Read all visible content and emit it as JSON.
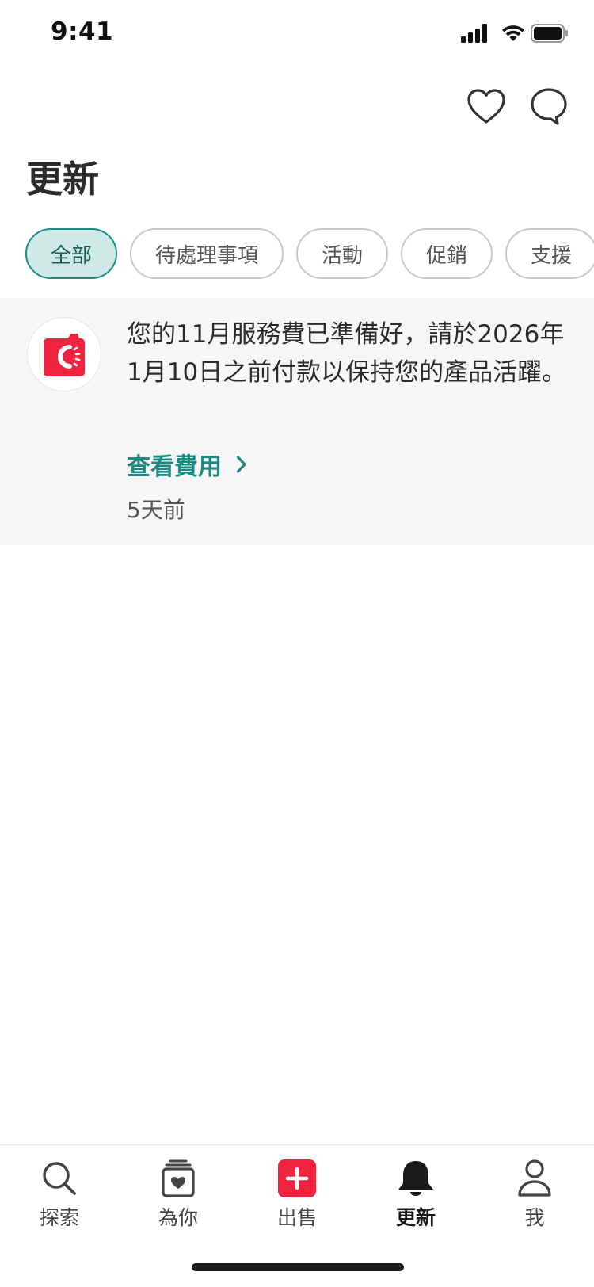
{
  "status_bar": {
    "time": "9:41"
  },
  "header": {
    "title": "更新",
    "actions": [
      {
        "icon": "heart-icon"
      },
      {
        "icon": "chat-bubble-icon"
      }
    ]
  },
  "filters": {
    "selected": "全部",
    "chips": [
      "全部",
      "待處理事項",
      "活動",
      "促銷",
      "支援"
    ]
  },
  "notifications": [
    {
      "app_icon": "carousell-logo-icon",
      "message": "您的11月服務費已準備好，請於2026年1月10日之前付款以保持您的產品活躍。",
      "link_label": "查看費用",
      "time": "5天前"
    }
  ],
  "tab_bar": {
    "active": "更新",
    "tabs": [
      {
        "label": "探索",
        "icon": "search-icon"
      },
      {
        "label": "為你",
        "icon": "for-you-icon"
      },
      {
        "label": "出售",
        "icon": "sell-plus-icon"
      },
      {
        "label": "更新",
        "icon": "bell-icon"
      },
      {
        "label": "我",
        "icon": "profile-icon"
      }
    ]
  },
  "colors": {
    "accent": "#1b8a82",
    "chip_active_bg": "#cfe9e6",
    "sell_button": "#f0233f",
    "card_bg": "#f6f6f6"
  }
}
